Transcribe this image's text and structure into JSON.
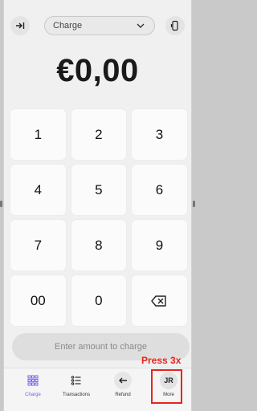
{
  "topbar": {
    "left_icon": "collapse-arrow-icon",
    "select_value": "Charge",
    "right_icon": "card-reader-icon"
  },
  "amount": "€0,00",
  "keypad": {
    "keys": [
      "1",
      "2",
      "3",
      "4",
      "5",
      "6",
      "7",
      "8",
      "9",
      "00",
      "0"
    ],
    "backspace_icon": "backspace-icon"
  },
  "charge_button": "Enter amount to charge",
  "annotation": "Press 3x",
  "nav": {
    "charge": "Charge",
    "transactions": "Transactions",
    "refund": "Refund",
    "more": "More",
    "more_avatar": "JR"
  },
  "colors": {
    "accent": "#7d5cf0",
    "annotation": "#e8241a",
    "background": "#f0f0f0"
  }
}
